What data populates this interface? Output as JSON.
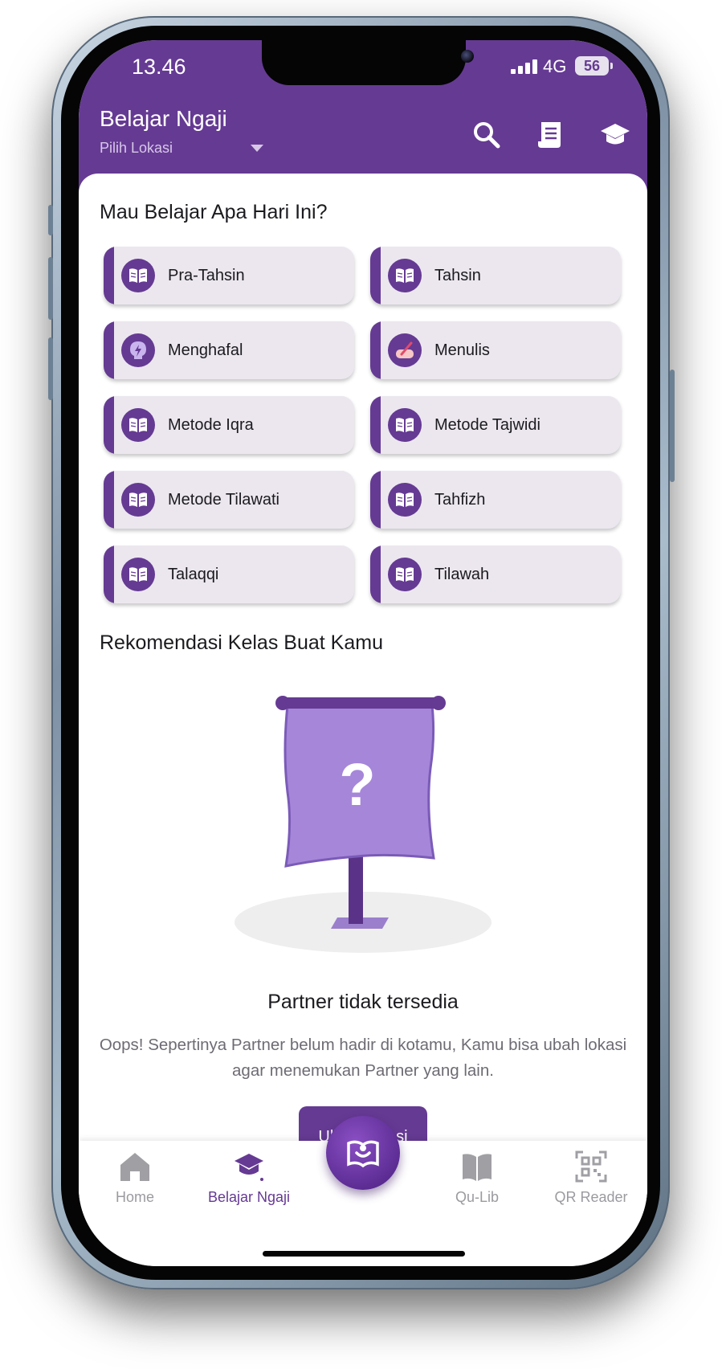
{
  "status_bar": {
    "time": "13.46",
    "network": "4G",
    "battery": "56"
  },
  "header": {
    "title": "Belajar Ngaji",
    "location_placeholder": "Pilih Lokasi"
  },
  "header_icons": [
    "search-icon",
    "receipt-icon",
    "graduation-cap-icon"
  ],
  "section_learn": {
    "title": "Mau Belajar Apa Hari Ini?"
  },
  "categories": [
    {
      "label": "Pra-Tahsin",
      "icon": "book-icon"
    },
    {
      "label": "Tahsin",
      "icon": "book-icon"
    },
    {
      "label": "Menghafal",
      "icon": "brain-icon"
    },
    {
      "label": "Menulis",
      "icon": "writing-hand-icon"
    },
    {
      "label": "Metode Iqra",
      "icon": "book-icon"
    },
    {
      "label": "Metode Tajwidi",
      "icon": "book-icon"
    },
    {
      "label": "Metode Tilawati",
      "icon": "book-icon"
    },
    {
      "label": "Tahfizh",
      "icon": "book-icon"
    },
    {
      "label": "Talaqqi",
      "icon": "book-icon"
    },
    {
      "label": "Tilawah",
      "icon": "book-icon"
    }
  ],
  "section_recommend": {
    "title": "Rekomendasi Kelas Buat Kamu"
  },
  "empty_state": {
    "illustration_mark": "?",
    "title": "Partner tidak tersedia",
    "description": "Oops! Sepertinya Partner belum hadir di kotamu, Kamu bisa ubah lokasi agar menemukan Partner yang lain.",
    "button_label": "Ubah Lokasi"
  },
  "bottom_nav": [
    {
      "label": "Home",
      "icon": "home-icon",
      "active": false
    },
    {
      "label": "Belajar Ngaji",
      "icon": "graduation-cap-icon",
      "active": true
    },
    {
      "label": "Qu-Lib",
      "icon": "open-book-icon",
      "active": false
    },
    {
      "label": "QR Reader",
      "icon": "qr-code-icon",
      "active": false
    }
  ],
  "colors": {
    "primary": "#653a93",
    "card_bg": "#ece7ef",
    "inactive_nav": "#9b9a9f",
    "active_nav": "#653a93",
    "text_secondary": "#6e6b73"
  }
}
